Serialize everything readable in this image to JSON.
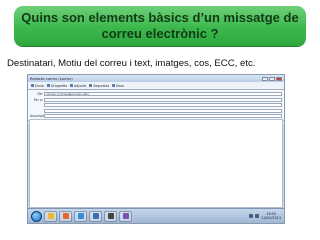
{
  "slide": {
    "title_line1": "Quins son elements bàsics d’un missatge de",
    "title_line2": "correu electrònic ?",
    "subtitle": "Destinatari, Motiu del correu i text, imatges, cos, ECC, etc.",
    "title_color": "#3bb84c"
  },
  "window": {
    "title": "Redacta correu (correu)",
    "toolbar": [
      "Envia",
      "Ortografia",
      "Adjunta",
      "Seguretat",
      "Desa"
    ],
    "fields": [
      {
        "label": "De:",
        "value": "correu <correu@correu.cat>"
      },
      {
        "label": "Per a:",
        "value": ""
      },
      {
        "label": "",
        "value": ""
      },
      {
        "label": "",
        "value": ""
      },
      {
        "label": "Assumpte:",
        "value": ""
      }
    ],
    "format_bar": {
      "style": "Paràgraf",
      "font": "Amplada variable",
      "bold": "B"
    }
  },
  "taskbar": {
    "icons": [
      {
        "name": "explorer-icon",
        "color": "#e8b83a"
      },
      {
        "name": "firefox-icon",
        "color": "#e2682b"
      },
      {
        "name": "media-icon",
        "color": "#2f8fd8"
      },
      {
        "name": "mail-icon",
        "color": "#3a6fb8"
      },
      {
        "name": "terminal-icon",
        "color": "#444444"
      },
      {
        "name": "app-icon",
        "color": "#7a55b0"
      }
    ],
    "clock_time": "16:50",
    "clock_date": "14/02/2013"
  }
}
